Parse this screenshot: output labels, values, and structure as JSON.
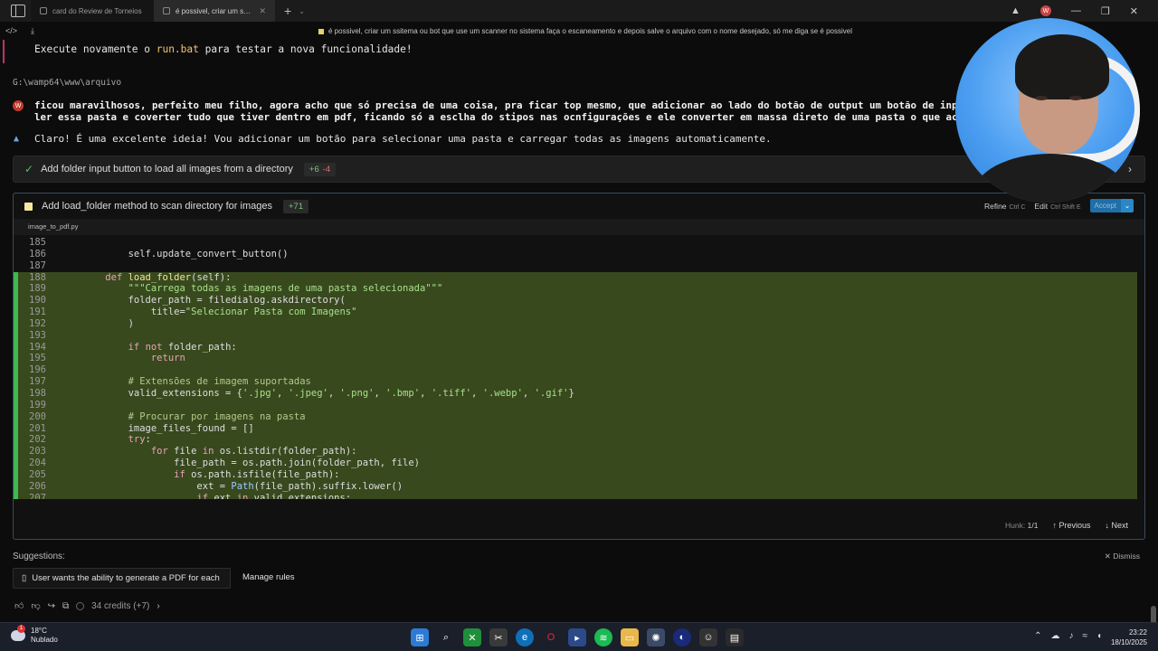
{
  "browser": {
    "tabs": [
      {
        "label": "card do Review de Torneios"
      },
      {
        "label": "é possivel, criar um ssitema ou bot que use um scanner no sistema faça"
      }
    ],
    "new_tab": "+",
    "tab_list": "⌄",
    "user_badge": "W"
  },
  "titlebar": {
    "doc_title": "é possivel, criar um ssitema ou bot que use um scanner no sistema faça o escaneamento e depois salve o arquivo com o nome desejado, só me diga se é possivel"
  },
  "chat": {
    "previous_line": {
      "prefix": "Execute novamente o ",
      "highlight": "run.bat",
      "suffix": " para testar a nova funcionalidade!"
    },
    "cwd": "G:\\wamp64\\www\\arquivo",
    "user_avatar": "W",
    "user_message_1": "ficou maravilhosos, perfeito meu filho, agora acho que só precisa de uma coisa, pra ficar top mesmo, que adicionar ao lado do botão de output um botão de input, que possa",
    "user_message_2": "ler essa pasta e coverter tudo que tiver dentro em pdf, ficando só a esclha do stipos nas ocnfigurações e ele converter em massa direto de uma pasta o que achas ?",
    "assistant_message": "Claro! É uma excelente ideia! Vou adicionar um botão para selecionar uma pasta e carregar todas as imagens automaticamente."
  },
  "step_done": {
    "label": "Add folder input button to load all images from a directory",
    "added": "+6",
    "removed": "-4"
  },
  "step_pending": {
    "label": "Add load_folder method to scan directory for images",
    "added": "+71",
    "refine": "Refine",
    "refine_kbd": "Ctrl C",
    "edit": "Edit",
    "edit_kbd": "Ctrl Shift E",
    "accept": "Accept",
    "accept_more": "⌄",
    "file_tab": "image_to_pdf.py",
    "hunk_label": "Hunk:",
    "hunk_value": "1/1",
    "previous": "Previous",
    "next": "Next"
  },
  "code_lines": [
    {
      "n": "185",
      "added": false,
      "t": ""
    },
    {
      "n": "186",
      "added": false,
      "t": "        self.update_convert_button()"
    },
    {
      "n": "187",
      "added": false,
      "t": ""
    },
    {
      "n": "188",
      "added": true,
      "t": "    def load_folder(self):"
    },
    {
      "n": "189",
      "added": true,
      "t": "        \"\"\"Carrega todas as imagens de uma pasta selecionada\"\"\""
    },
    {
      "n": "190",
      "added": true,
      "t": "        folder_path = filedialog.askdirectory("
    },
    {
      "n": "191",
      "added": true,
      "t": "            title=\"Selecionar Pasta com Imagens\""
    },
    {
      "n": "192",
      "added": true,
      "t": "        )"
    },
    {
      "n": "193",
      "added": true,
      "t": ""
    },
    {
      "n": "194",
      "added": true,
      "t": "        if not folder_path:"
    },
    {
      "n": "195",
      "added": true,
      "t": "            return"
    },
    {
      "n": "196",
      "added": true,
      "t": ""
    },
    {
      "n": "197",
      "added": true,
      "t": "        # Extensões de imagem suportadas"
    },
    {
      "n": "198",
      "added": true,
      "t": "        valid_extensions = {'.jpg', '.jpeg', '.png', '.bmp', '.tiff', '.webp', '.gif'}"
    },
    {
      "n": "199",
      "added": true,
      "t": ""
    },
    {
      "n": "200",
      "added": true,
      "t": "        # Procurar por imagens na pasta"
    },
    {
      "n": "201",
      "added": true,
      "t": "        image_files_found = []"
    },
    {
      "n": "202",
      "added": true,
      "t": "        try:"
    },
    {
      "n": "203",
      "added": true,
      "t": "            for file in os.listdir(folder_path):"
    },
    {
      "n": "204",
      "added": true,
      "t": "                file_path = os.path.join(folder_path, file)"
    },
    {
      "n": "205",
      "added": true,
      "t": "                if os.path.isfile(file_path):"
    },
    {
      "n": "206",
      "added": true,
      "t": "                    ext = Path(file_path).suffix.lower()"
    },
    {
      "n": "207",
      "added": true,
      "t": "                    if ext in valid_extensions:"
    }
  ],
  "suggestions": {
    "title": "Suggestions:",
    "dismiss": "Dismiss",
    "chip": "User wants the ability to generate a PDF for each",
    "manage_rules": "Manage rules"
  },
  "footer": {
    "credits": "34 credits (+7)"
  },
  "taskbar": {
    "temperature": "18°C",
    "condition": "Nublado",
    "time": "23:22",
    "date": "18/10/2025"
  },
  "colors": {
    "added_line_bg": "#38491e",
    "added_marker": "#3fb950",
    "accept_button": "#2a88c8",
    "panel_border": "#3d4a5a"
  }
}
